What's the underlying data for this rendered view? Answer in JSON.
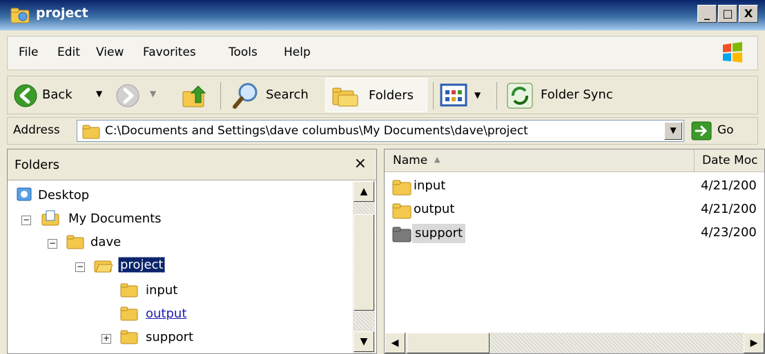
{
  "window": {
    "title": "project",
    "controls": {
      "minimize": "_",
      "maximize": "□",
      "close": "X"
    }
  },
  "menu": [
    "File",
    "Edit",
    "View",
    "Favorites",
    "Tools",
    "Help"
  ],
  "toolbar": {
    "back_label": "Back",
    "search_label": "Search",
    "folders_label": "Folders",
    "folder_sync_label": "Folder Sync"
  },
  "address": {
    "label": "Address",
    "value": "C:\\Documents and Settings\\dave columbus\\My Documents\\dave\\project",
    "go_label": "Go"
  },
  "folders_pane": {
    "title": "Folders",
    "close": "×",
    "tree": [
      {
        "label": "Desktop",
        "expander": ""
      },
      {
        "label": "My Documents",
        "expander": "⊟"
      },
      {
        "label": "dave",
        "expander": "⊟"
      },
      {
        "label": "project",
        "expander": "⊟",
        "selected": true
      },
      {
        "label": "input",
        "expander": ""
      },
      {
        "label": "output",
        "expander": "",
        "hovered": true
      },
      {
        "label": "support",
        "expander": "⊞"
      }
    ]
  },
  "files": {
    "columns": [
      "Name",
      "Date Moc"
    ],
    "sort_glyph": "▲",
    "rows": [
      {
        "name": "input",
        "date": "4/21/200"
      },
      {
        "name": "output",
        "date": "4/21/200"
      },
      {
        "name": "support",
        "date": "4/23/200",
        "highlighted": true
      }
    ]
  },
  "colors": {
    "titlebar_start": "#0a246a",
    "selection": "#0a246a",
    "folder_yellow": "#f3c84b",
    "folder_gray": "#6e6e6e"
  }
}
